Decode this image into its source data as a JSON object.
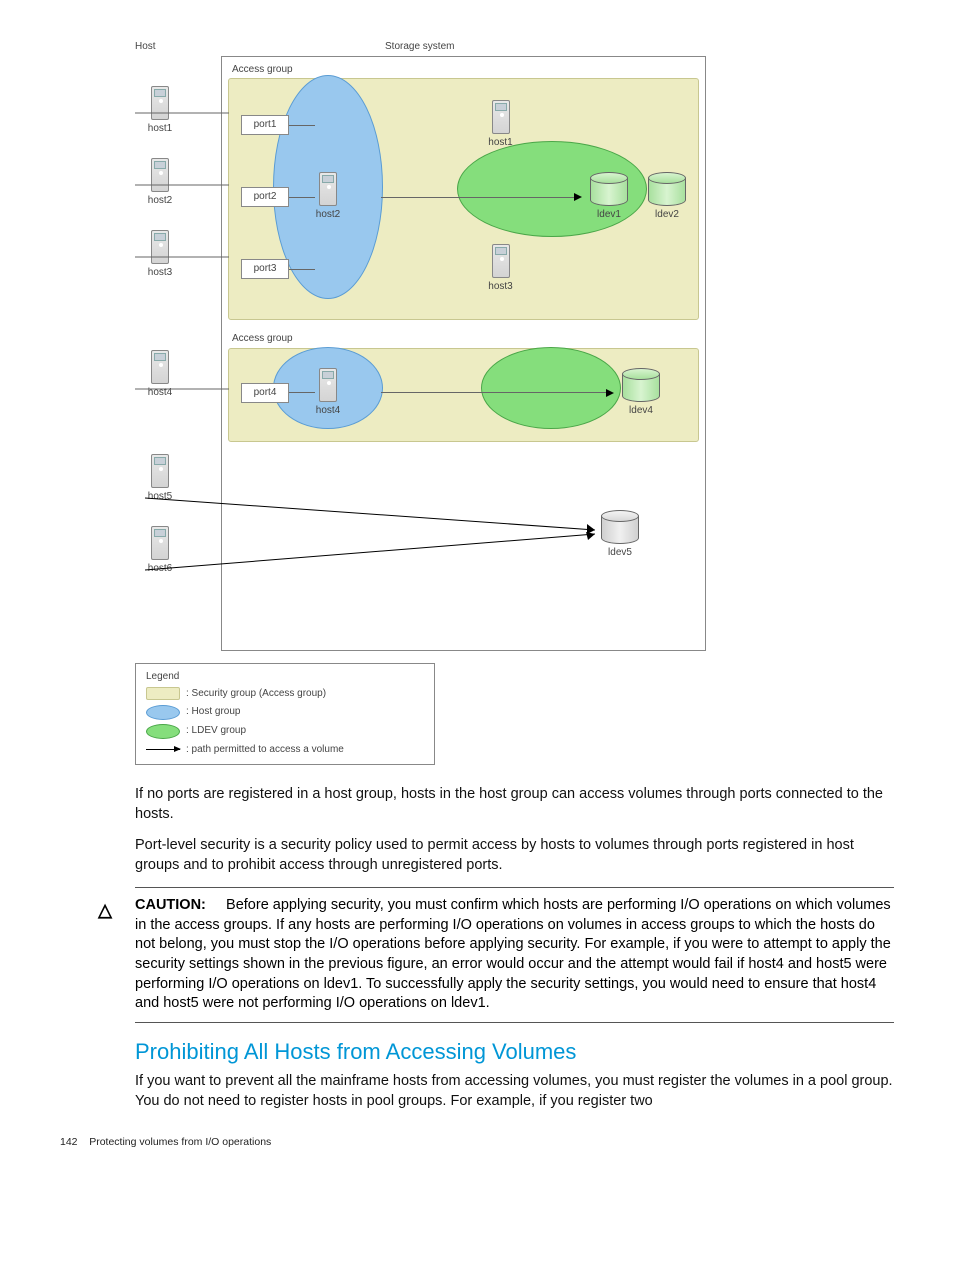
{
  "diagram": {
    "top_labels": {
      "host": "Host",
      "storage": "Storage system"
    },
    "access_group_label": "Access group",
    "external_hosts": [
      "host1",
      "host2",
      "host3",
      "host4",
      "host5",
      "host6"
    ],
    "ports": [
      "port1",
      "port2",
      "port3",
      "port4"
    ],
    "group1_hosts": [
      "host1",
      "host2",
      "host3"
    ],
    "group1_ldevs": [
      "ldev1",
      "ldev2"
    ],
    "group2_host": "host4",
    "group2_ldev": "ldev4",
    "bottom_ldev": "ldev5",
    "legend": {
      "title": "Legend",
      "security": ": Security group (Access group)",
      "host_group": ": Host group",
      "ldev_group": ": LDEV group",
      "path": ": path permitted to access a volume"
    }
  },
  "paragraphs": {
    "p1": "If no ports are registered in a host group, hosts in the host group can access volumes through ports connected to the hosts.",
    "p2": "Port-level security is a security policy used to permit access by hosts to volumes through ports registered in host groups and to prohibit access through unregistered ports."
  },
  "caution": {
    "label": "CAUTION:",
    "text": "Before applying security, you must confirm which hosts are performing I/O operations on which volumes in the access groups. If any hosts are performing I/O operations on volumes in access groups to which the hosts do not belong, you must stop the I/O operations before applying security. For example, if you were to attempt to apply the security settings shown in the previous figure, an error would occur and the attempt would fail if host4 and host5 were performing I/O operations on ldev1. To successfully apply the security settings, you would need to ensure that host4 and host5 were not performing I/O operations on ldev1."
  },
  "section": {
    "heading": "Prohibiting All Hosts from Accessing Volumes",
    "p3": "If you want to prevent all the mainframe hosts from accessing volumes, you must register the volumes in a pool group. You do not need to register hosts in pool groups. For example, if you register two"
  },
  "footer": {
    "page": "142",
    "chapter": "Protecting volumes from I/O operations"
  }
}
